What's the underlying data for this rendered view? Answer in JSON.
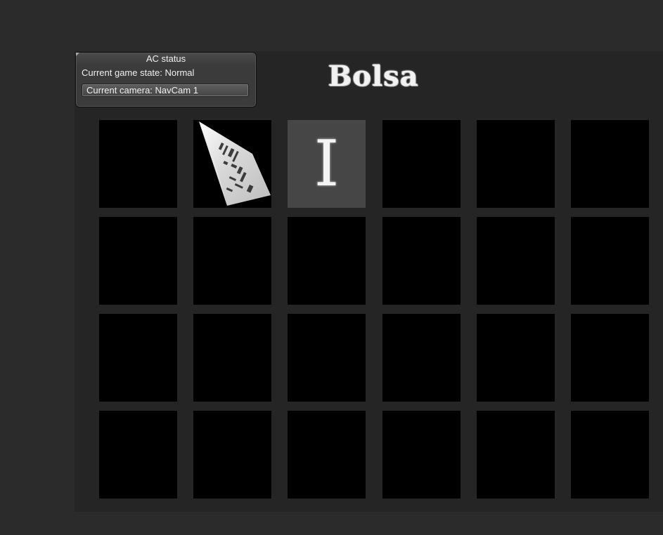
{
  "inventory": {
    "title": "Bolsa",
    "slots": [
      {
        "item": "",
        "item_icon": ""
      },
      {
        "item": "",
        "item_icon": "ticket-icon"
      },
      {
        "item": "I",
        "item_icon": "letter-i-icon",
        "selected": true
      },
      {
        "item": "",
        "item_icon": ""
      },
      {
        "item": "",
        "item_icon": ""
      },
      {
        "item": "",
        "item_icon": ""
      }
    ],
    "rows": 4,
    "columns": 6
  },
  "ac_status": {
    "title": "AC status",
    "game_state": "Current game state: Normal",
    "camera": "Current camera: NavCam 1"
  },
  "colors": {
    "background": "#2b2b2b",
    "panel": "#252525",
    "slot": "#000000",
    "slot_selected": "#464646",
    "title_text": "#f2f2f2"
  }
}
